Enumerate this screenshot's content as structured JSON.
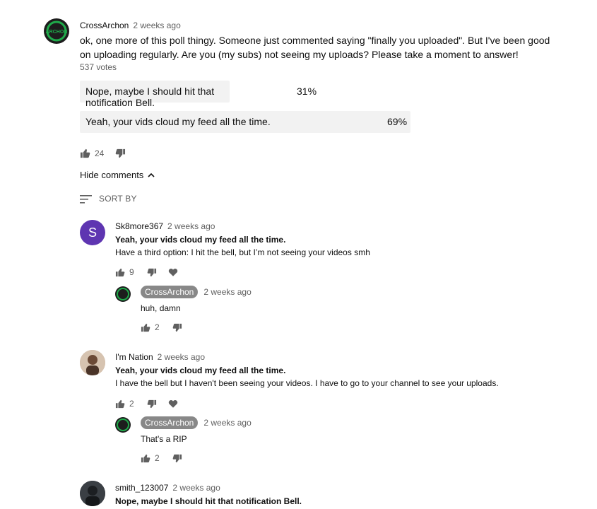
{
  "post": {
    "author": "CrossArchon",
    "time": "2 weeks ago",
    "text_line1": "ok, one more of this poll thingy. Someone just commented saying \"finally you uploaded\". But I've been good",
    "text_line2": "on uploading regularly. Are you (my subs) not seeing my uploads? Please take a moment to answer!",
    "votes": "537 votes",
    "poll": [
      {
        "label": "Nope, maybe I should hit that notification Bell.",
        "pct": "31%",
        "fraction": 0.31
      },
      {
        "label": "Yeah, your vids cloud my feed all the time.",
        "pct": "69%",
        "fraction": 0.69
      }
    ],
    "likes": "24",
    "hide_comments": "Hide comments",
    "sort_by": "SORT BY",
    "avatar_text": "ARCHON"
  },
  "comments": [
    {
      "author": "Sk8more367",
      "time": "2 weeks ago",
      "avatar_letter": "S",
      "avatar_color": "#5e35b1",
      "vote": "Yeah, your vids cloud my feed all the time.",
      "text": "Have a third option: I hit the bell, but I’m not seeing your videos smh",
      "likes": "9",
      "reply": {
        "author": "CrossArchon",
        "time": "2 weeks ago",
        "text": "huh, damn",
        "likes": "2"
      }
    },
    {
      "author": "I'm Nation",
      "time": "2 weeks ago",
      "vote": "Yeah, your vids cloud my feed all the time.",
      "text": "I have the bell but I haven't been seeing your videos. I have to go to your channel to see your uploads.",
      "likes": "2",
      "reply": {
        "author": "CrossArchon",
        "time": "2 weeks ago",
        "text": "That's a RIP",
        "likes": "2"
      }
    },
    {
      "author": "smith_123007",
      "time": "2 weeks ago",
      "vote": "Nope, maybe I should hit that notification Bell."
    }
  ],
  "colors": {
    "accent_green": "#1faa4a",
    "poll_bg": "#f2f2f2",
    "muted": "#606060"
  }
}
